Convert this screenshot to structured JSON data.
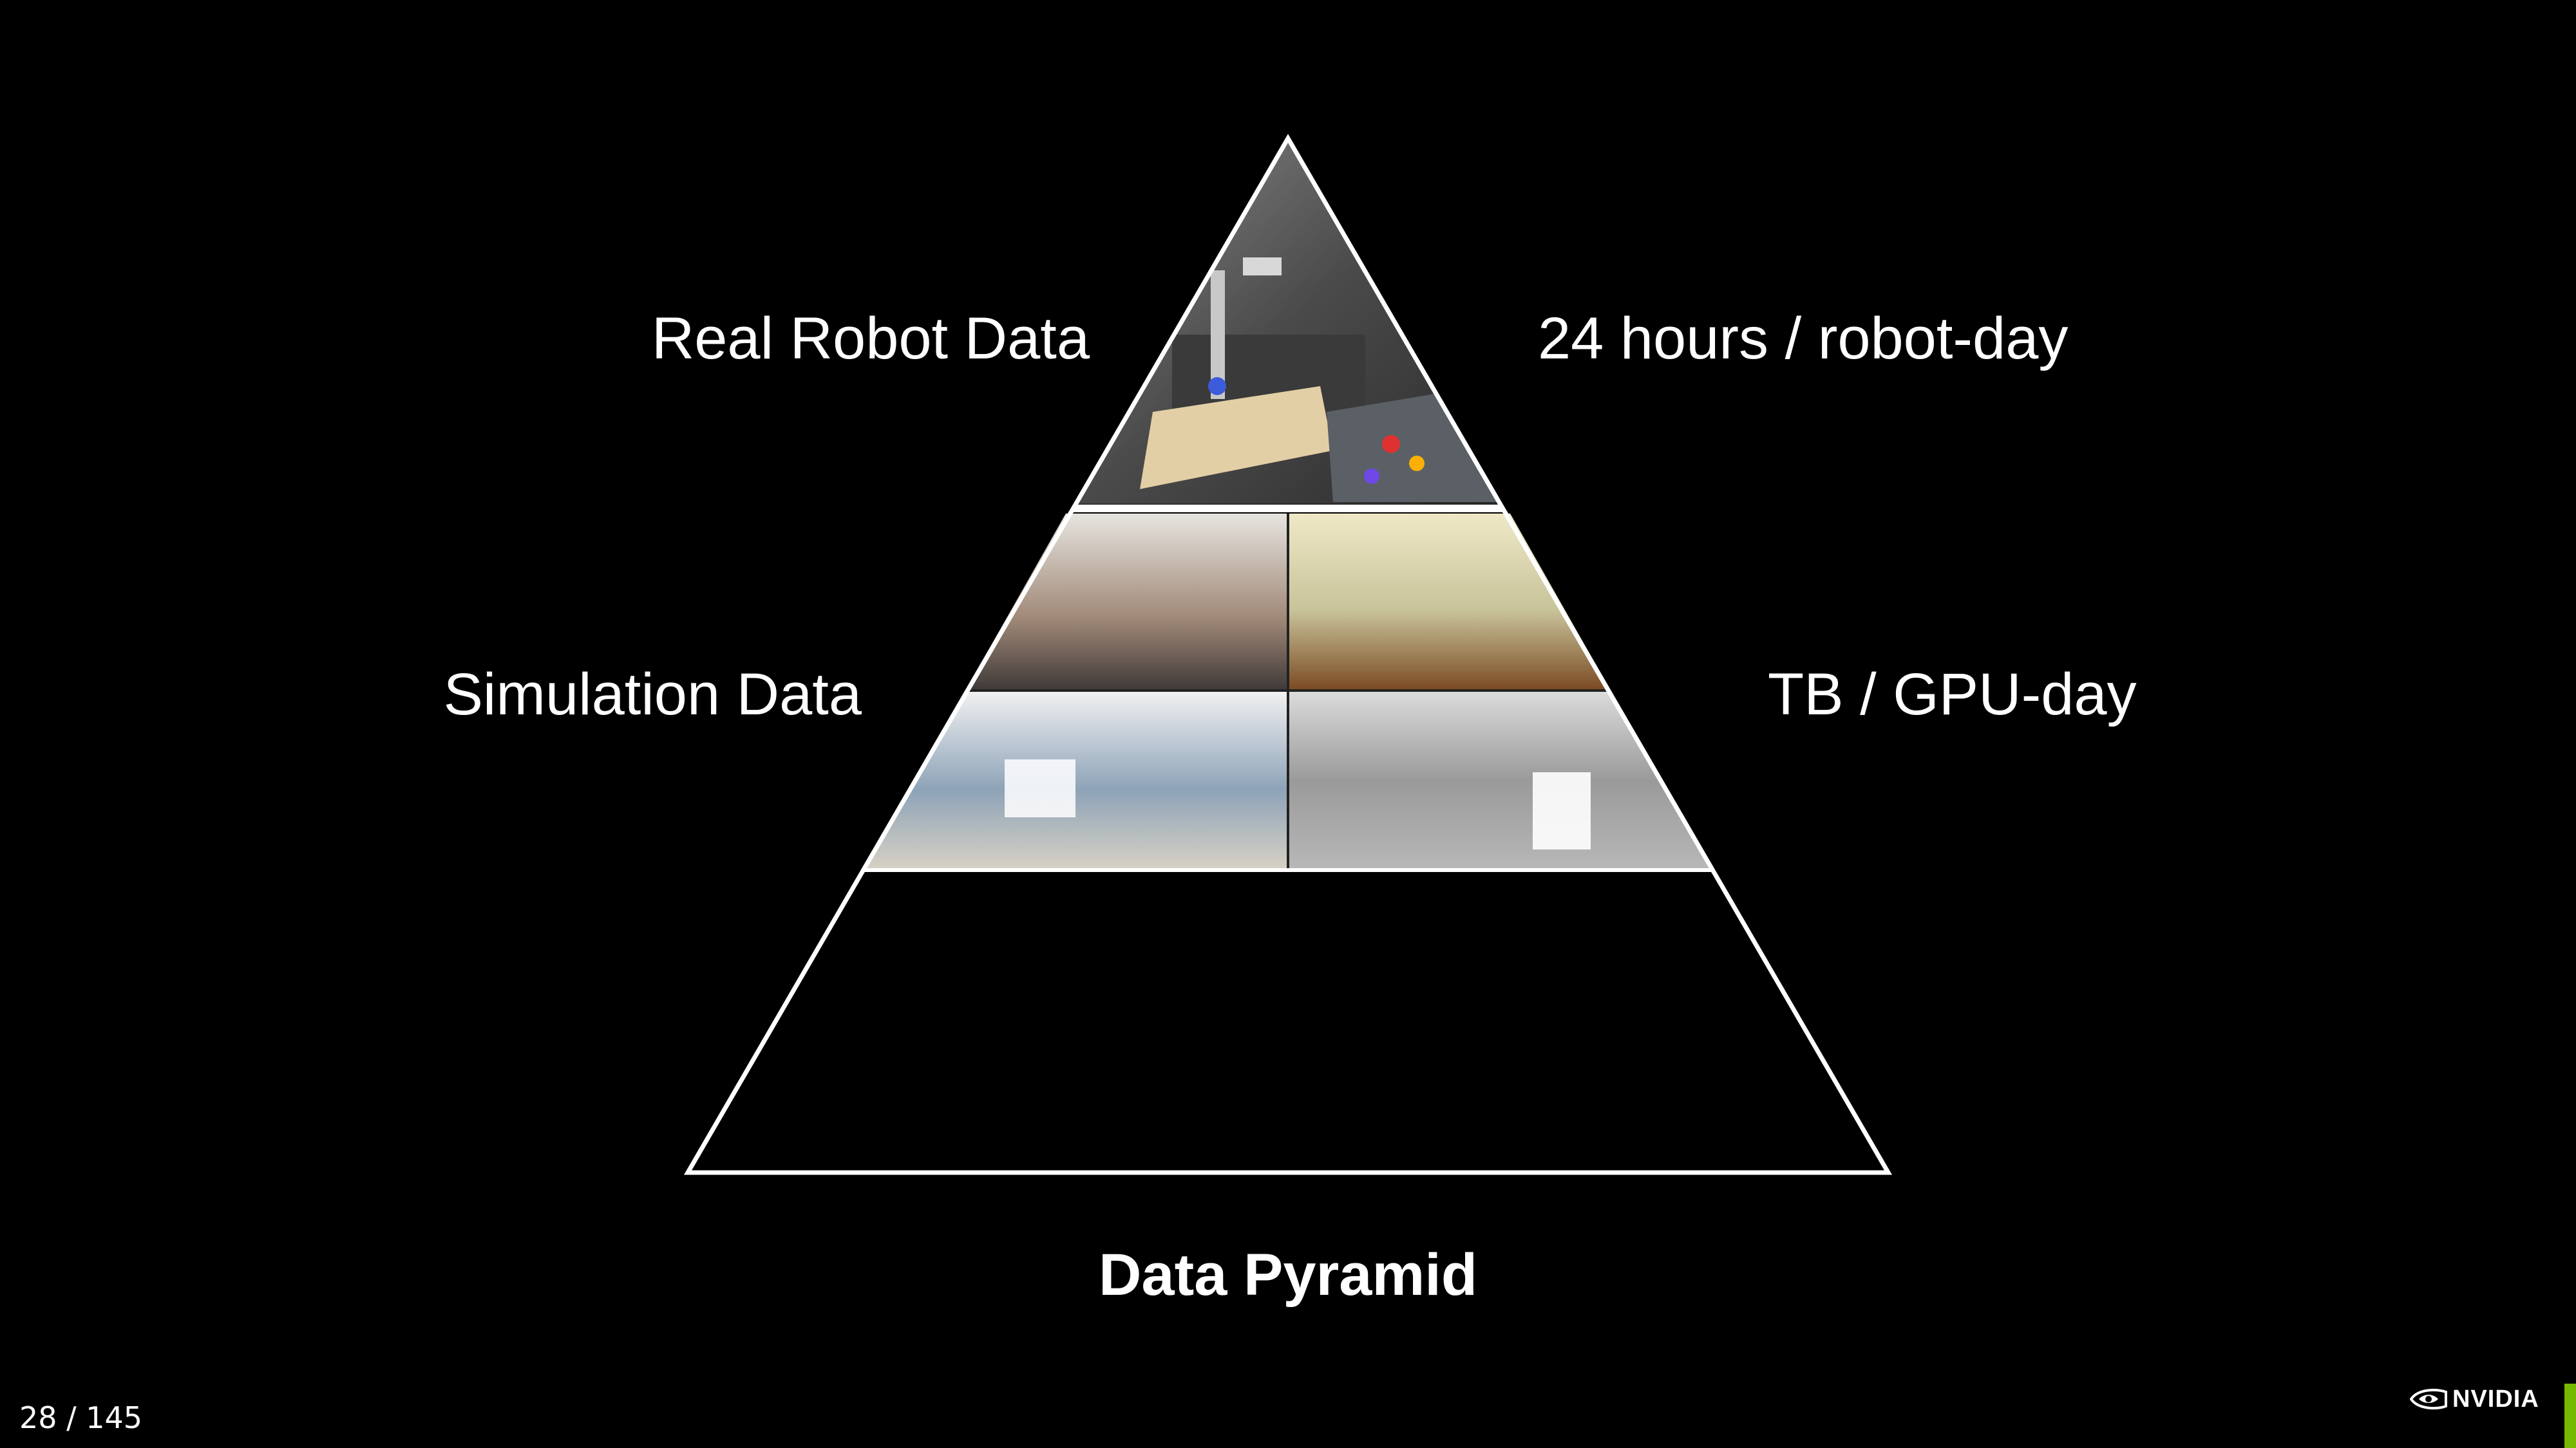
{
  "diagram": {
    "title": "Data Pyramid",
    "tiers": [
      {
        "name": "Real Robot Data",
        "rate": "24 hours / robot-day"
      },
      {
        "name": "Simulation Data",
        "rate": "TB / GPU-day"
      },
      {
        "name": "",
        "rate": ""
      }
    ]
  },
  "footer": {
    "page_number": "28 / 145",
    "brand": "NVIDIA"
  },
  "colors": {
    "background": "#000000",
    "outline": "#ffffff",
    "accent": "#76b900"
  }
}
